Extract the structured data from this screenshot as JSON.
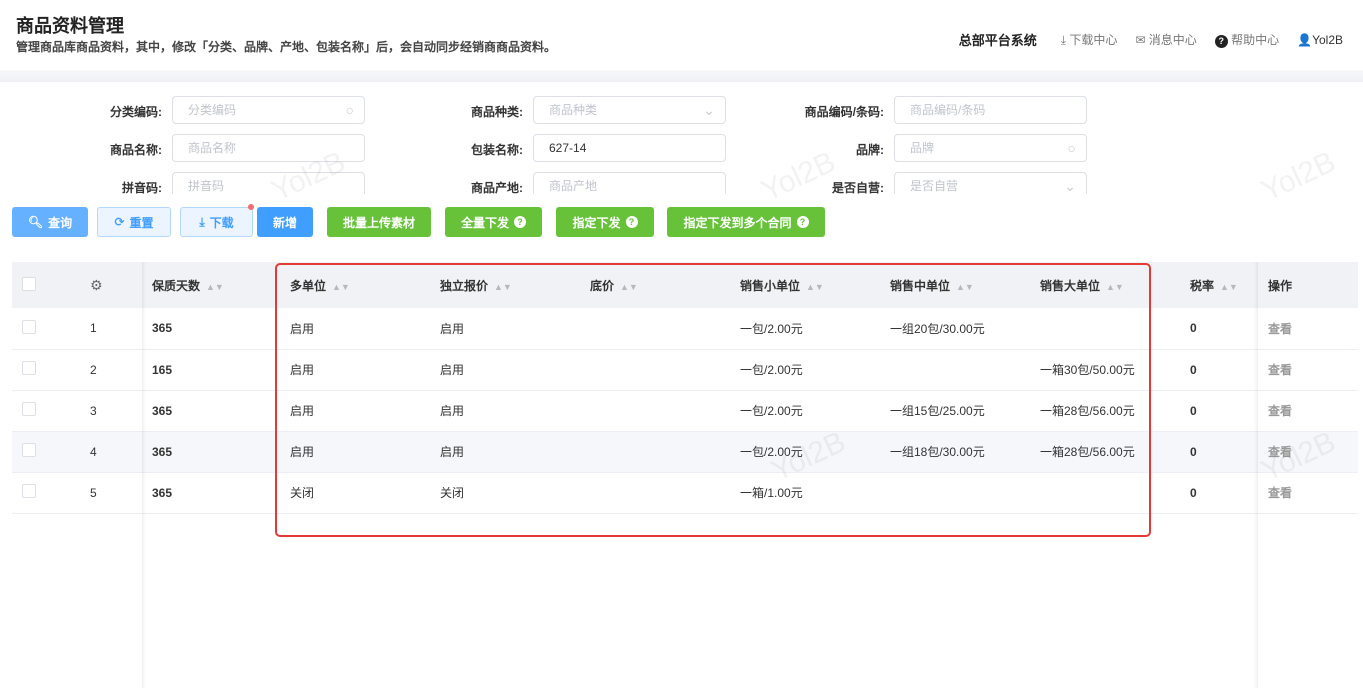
{
  "header": {
    "title": "商品资料管理",
    "subtitle": "管理商品库商品资料，其中，修改「分类、品牌、产地、包装名称」后，会自动同步经销商商品资料。",
    "system": "总部平台系统",
    "download_center": "下载中心",
    "message_center": "消息中心",
    "help_center": "帮助中心",
    "user": "Yol2B"
  },
  "filters": [
    {
      "label": "分类编码:",
      "placeholder": "分类编码",
      "value": "",
      "icon": "search"
    },
    {
      "label": "商品种类:",
      "placeholder": "商品种类",
      "value": "",
      "icon": "chevron"
    },
    {
      "label": "商品编码/条码:",
      "placeholder": "商品编码/条码",
      "value": "",
      "icon": ""
    },
    {
      "label": "商品名称:",
      "placeholder": "商品名称",
      "value": "",
      "icon": ""
    },
    {
      "label": "包装名称:",
      "placeholder": "",
      "value": "627-14",
      "icon": ""
    },
    {
      "label": "品牌:",
      "placeholder": "品牌",
      "value": "",
      "icon": "search"
    },
    {
      "label": "拼音码:",
      "placeholder": "拼音码",
      "value": "",
      "icon": ""
    },
    {
      "label": "商品产地:",
      "placeholder": "商品产地",
      "value": "",
      "icon": ""
    },
    {
      "label": "是否自营:",
      "placeholder": "是否自营",
      "value": "",
      "icon": "chevron"
    }
  ],
  "buttons": {
    "query": "查询",
    "reset": "重置",
    "download": "下载",
    "add": "新增",
    "batch_upload": "批量上传素材",
    "full_dispatch": "全量下发",
    "assign_dispatch": "指定下发",
    "assign_multi": "指定下发到多个合同"
  },
  "watermark": "Yol2B",
  "table": {
    "columns": [
      "保质天数",
      "多单位",
      "独立报价",
      "底价",
      "销售小单位",
      "销售中单位",
      "销售大单位",
      "税率",
      "操作"
    ],
    "rows": [
      {
        "index": "1",
        "shelf": "365",
        "multi": "启用",
        "indep": "启用",
        "floor": "",
        "small": "一包/2.00元",
        "mid": "一组20包/30.00元",
        "large": "",
        "tax": "0",
        "action": "查看"
      },
      {
        "index": "2",
        "shelf": "165",
        "multi": "启用",
        "indep": "启用",
        "floor": "",
        "small": "一包/2.00元",
        "mid": "",
        "large": "一箱30包/50.00元",
        "tax": "0",
        "action": "查看"
      },
      {
        "index": "3",
        "shelf": "365",
        "multi": "启用",
        "indep": "启用",
        "floor": "",
        "small": "一包/2.00元",
        "mid": "一组15包/25.00元",
        "large": "一箱28包/56.00元",
        "tax": "0",
        "action": "查看"
      },
      {
        "index": "4",
        "shelf": "365",
        "multi": "启用",
        "indep": "启用",
        "floor": "",
        "small": "一包/2.00元",
        "mid": "一组18包/30.00元",
        "large": "一箱28包/56.00元",
        "tax": "0",
        "action": "查看"
      },
      {
        "index": "5",
        "shelf": "365",
        "multi": "关闭",
        "indep": "关闭",
        "floor": "",
        "small": "一箱/1.00元",
        "mid": "",
        "large": "",
        "tax": "0",
        "action": "查看"
      }
    ]
  }
}
